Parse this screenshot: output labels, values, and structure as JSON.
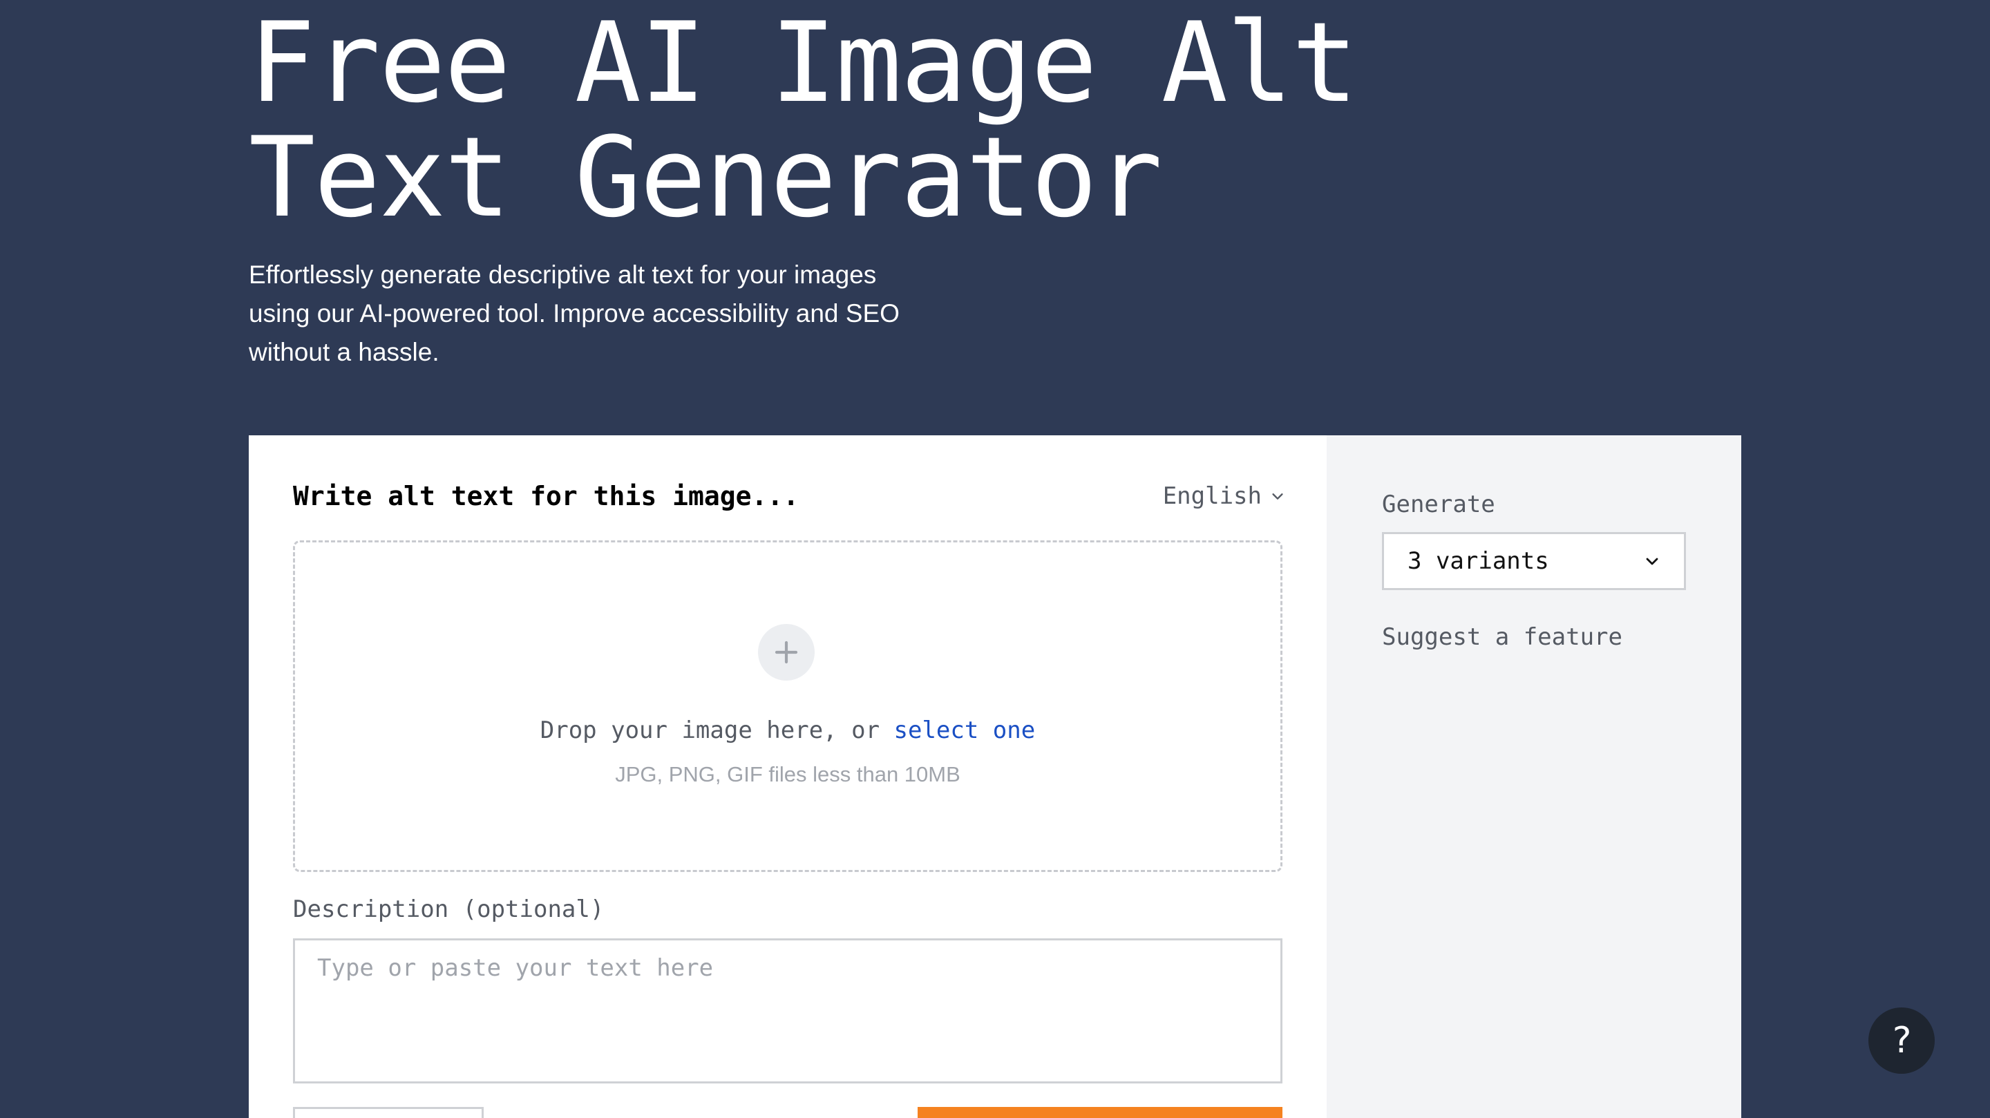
{
  "hero": {
    "title": "Free AI Image Alt Text Generator",
    "subtitle": "Effortlessly generate descriptive alt text for your images using our AI-powered tool. Improve accessibility and SEO without a hassle."
  },
  "tool": {
    "heading": "Write alt text for this image...",
    "language": "English",
    "dropzone": {
      "prompt": "Drop your image here, or ",
      "link": "select one",
      "hint": "JPG, PNG, GIF files less than 10MB"
    },
    "description": {
      "label": "Description (optional)",
      "placeholder": "Type or paste your text here"
    }
  },
  "sidebar": {
    "generate_label": "Generate",
    "variants_value": "3 variants",
    "suggest_link": "Suggest a feature"
  },
  "help": {
    "label": "?"
  },
  "colors": {
    "background": "#2e3a55",
    "accent": "#f58220",
    "link": "#1a4fc4"
  }
}
